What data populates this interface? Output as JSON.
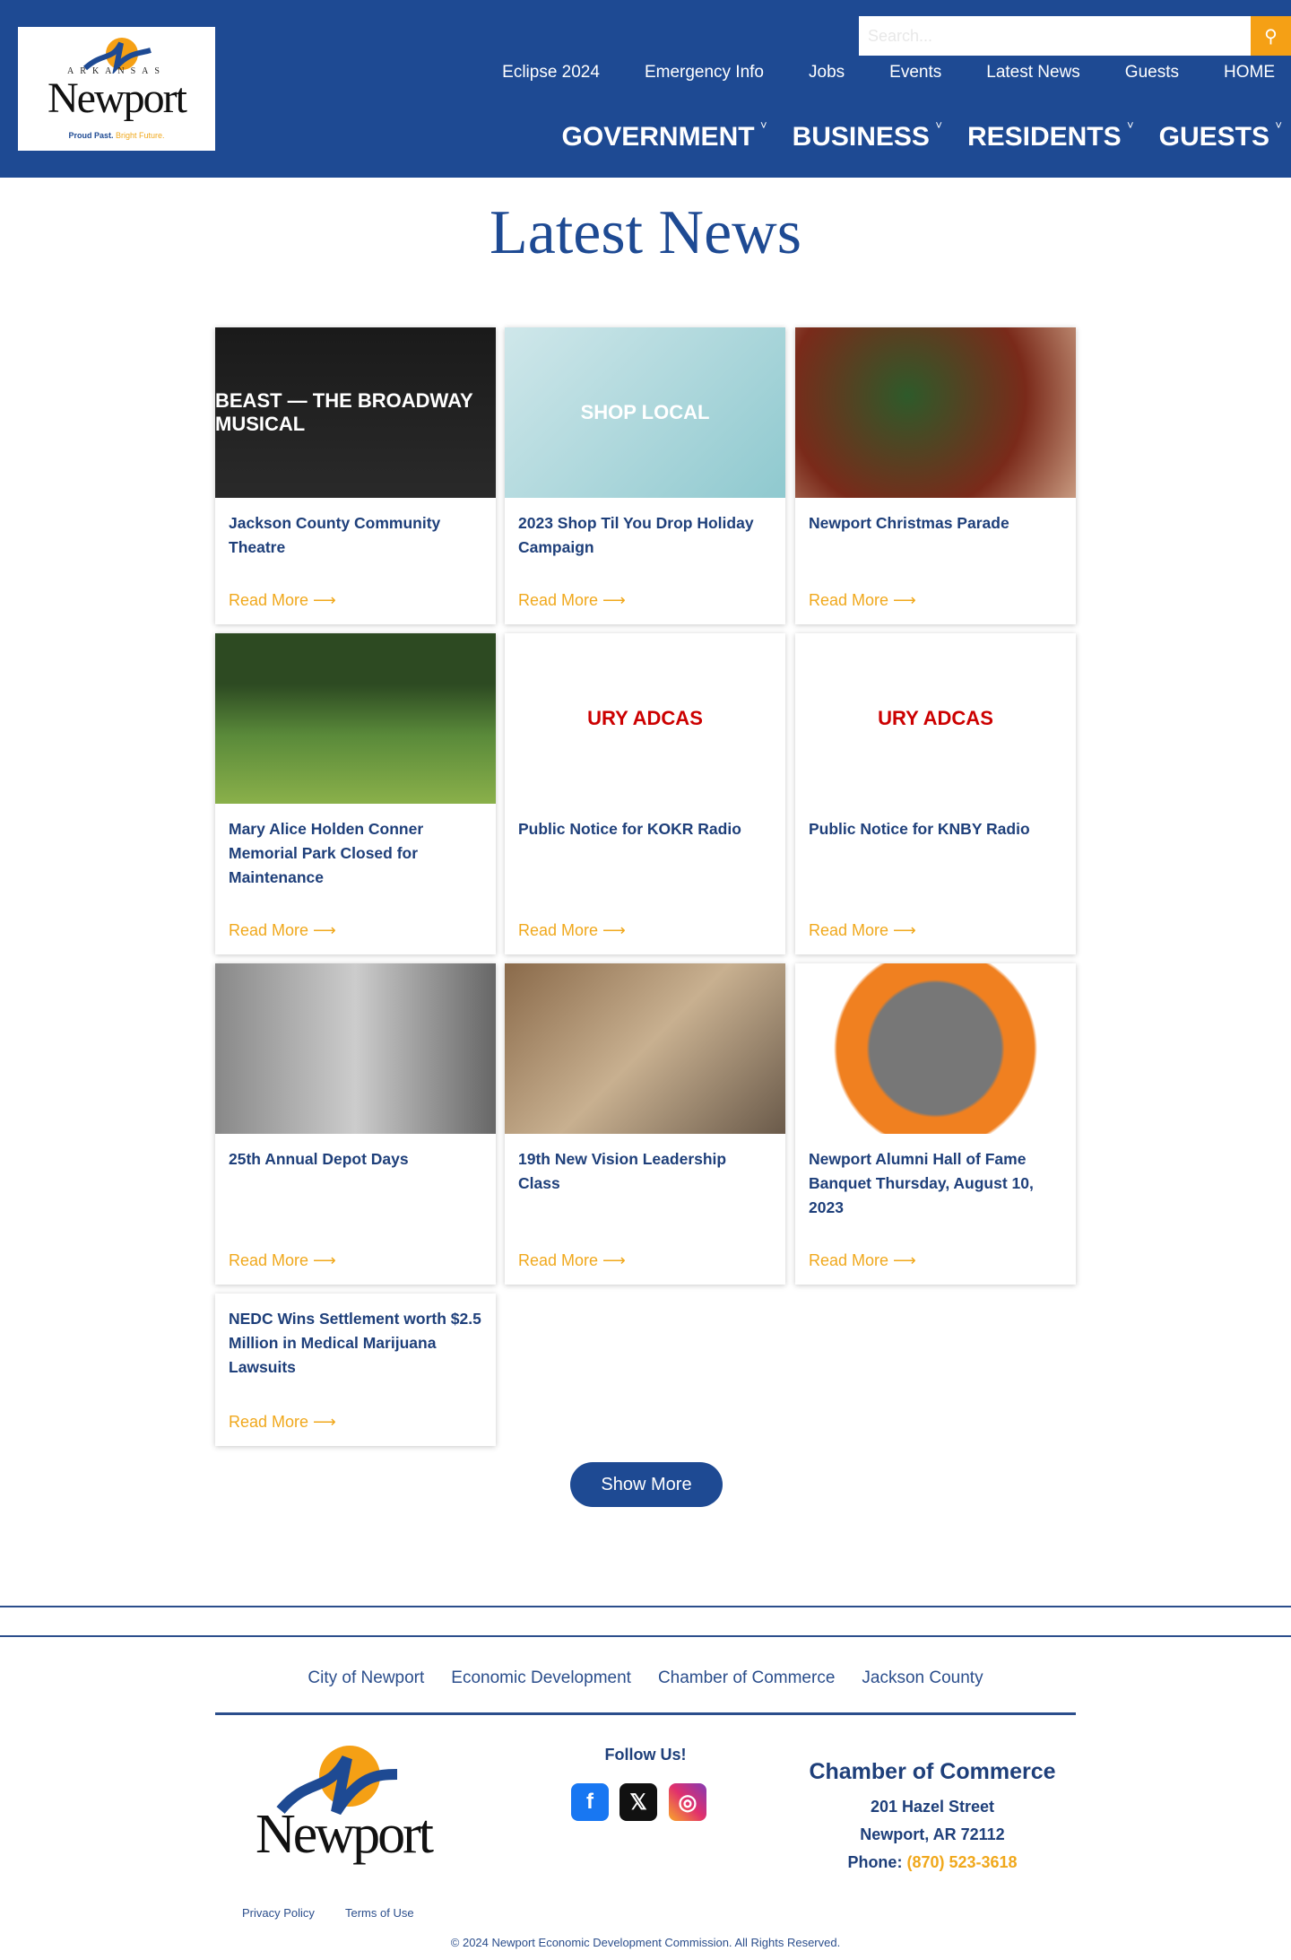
{
  "header": {
    "logo": {
      "top": "ARKANSAS",
      "name": "Newport",
      "tagline_a": "Proud Past.",
      "tagline_b": "Bright Future."
    },
    "search_placeholder": "Search...",
    "top_nav": [
      "Eclipse 2024",
      "Emergency Info",
      "Jobs",
      "Events",
      "Latest News",
      "Guests",
      "HOME"
    ],
    "main_nav": [
      "GOVERNMENT",
      "BUSINESS",
      "RESIDENTS",
      "GUESTS"
    ]
  },
  "page_title": "Latest News",
  "read_more": "Read More ⟶",
  "cards": [
    {
      "title": "Jackson County Community Theatre",
      "image_text": "BEAST — THE BROADWAY MUSICAL"
    },
    {
      "title": "2023 Shop Til You Drop Holiday Campaign",
      "image_text": "SHOP LOCAL"
    },
    {
      "title": "Newport Christmas Parade",
      "image_text": ""
    },
    {
      "title": "Mary Alice Holden Conner Memorial Park Closed for Maintenance",
      "image_text": ""
    },
    {
      "title": "Public Notice for KOKR Radio",
      "image_text": "URY ADCAS"
    },
    {
      "title": "Public Notice for KNBY Radio",
      "image_text": "URY ADCAS"
    },
    {
      "title": "25th Annual Depot Days",
      "image_text": ""
    },
    {
      "title": "19th New Vision Leadership Class",
      "image_text": ""
    },
    {
      "title": "Newport Alumni Hall of Fame Banquet Thursday, August 10, 2023",
      "image_text": ""
    },
    {
      "title": "NEDC Wins Settlement worth $2.5 Million in Medical Marijuana Lawsuits",
      "image_text": ""
    }
  ],
  "show_more": "Show More",
  "footer": {
    "links": [
      "City of Newport",
      "Economic Development",
      "Chamber of Commerce",
      "Jackson County"
    ],
    "logo_name": "Newport",
    "follow": "Follow Us!",
    "chamber": {
      "title": "Chamber of Commerce",
      "street": "201 Hazel Street",
      "city": "Newport, AR 72112",
      "phone_label": "Phone:",
      "phone": "(870) 523-3618"
    },
    "privacy": "Privacy Policy",
    "terms": "Terms of Use",
    "copyright": "© 2024 Newport Economic Development Commission. All Rights Reserved."
  },
  "colors": {
    "brand": "#1e4a93",
    "accent": "#f0a81c"
  }
}
